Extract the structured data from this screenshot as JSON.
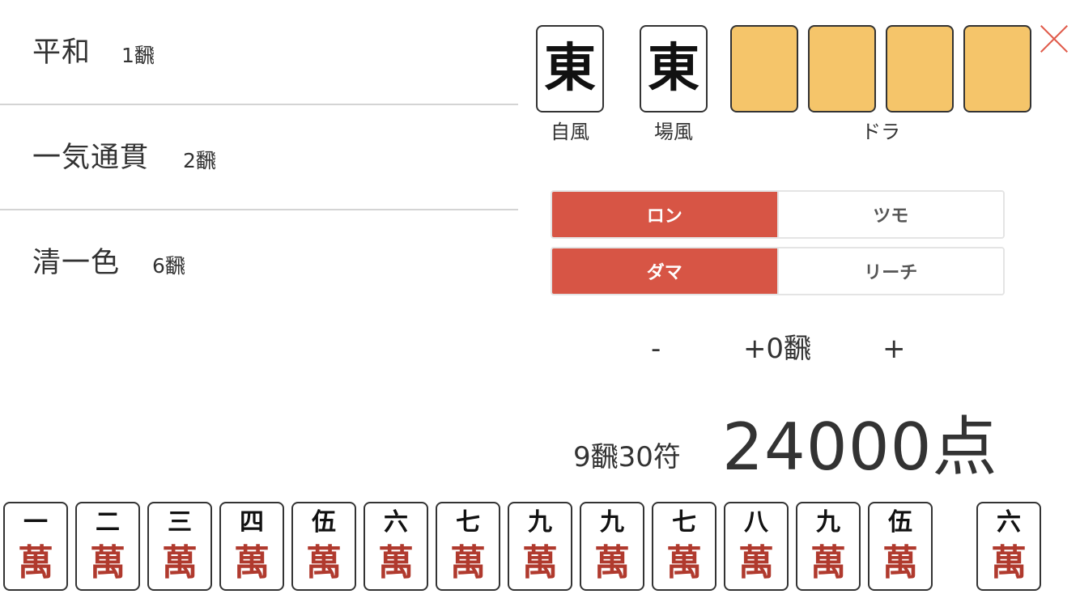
{
  "yaku": [
    {
      "name": "平和",
      "han": "1飜"
    },
    {
      "name": "一気通貫",
      "han": "2飜"
    },
    {
      "name": "清一色",
      "han": "6飜"
    }
  ],
  "wind_tiles": {
    "seat": {
      "glyph": "東",
      "caption": "自風"
    },
    "round": {
      "glyph": "東",
      "caption": "場風"
    }
  },
  "dora": {
    "caption": "ドラ",
    "count": 4
  },
  "win_type": {
    "ron": "ロン",
    "tsumo": "ツモ",
    "selected": "ロン"
  },
  "riichi": {
    "dama": "ダマ",
    "riichi": "リーチ",
    "selected": "ダマ"
  },
  "han_adjust": {
    "minus": "-",
    "value": "+0飜",
    "plus": "+"
  },
  "result": {
    "han_fu": "9飜30符",
    "score": "24000点"
  },
  "hand": [
    {
      "num": "一",
      "suit": "萬"
    },
    {
      "num": "二",
      "suit": "萬"
    },
    {
      "num": "三",
      "suit": "萬"
    },
    {
      "num": "四",
      "suit": "萬"
    },
    {
      "num": "伍",
      "suit": "萬"
    },
    {
      "num": "六",
      "suit": "萬"
    },
    {
      "num": "七",
      "suit": "萬"
    },
    {
      "num": "九",
      "suit": "萬"
    },
    {
      "num": "九",
      "suit": "萬"
    },
    {
      "num": "七",
      "suit": "萬"
    },
    {
      "num": "八",
      "suit": "萬"
    },
    {
      "num": "九",
      "suit": "萬"
    },
    {
      "num": "伍",
      "suit": "萬"
    }
  ],
  "winning_tile": {
    "num": "六",
    "suit": "萬"
  },
  "colors": {
    "accent": "#d75545",
    "dora_tile": "#f5c56a",
    "close_icon": "#e05a4a",
    "suit_red": "#b03a2e"
  },
  "icons": {
    "close": "close-icon"
  }
}
